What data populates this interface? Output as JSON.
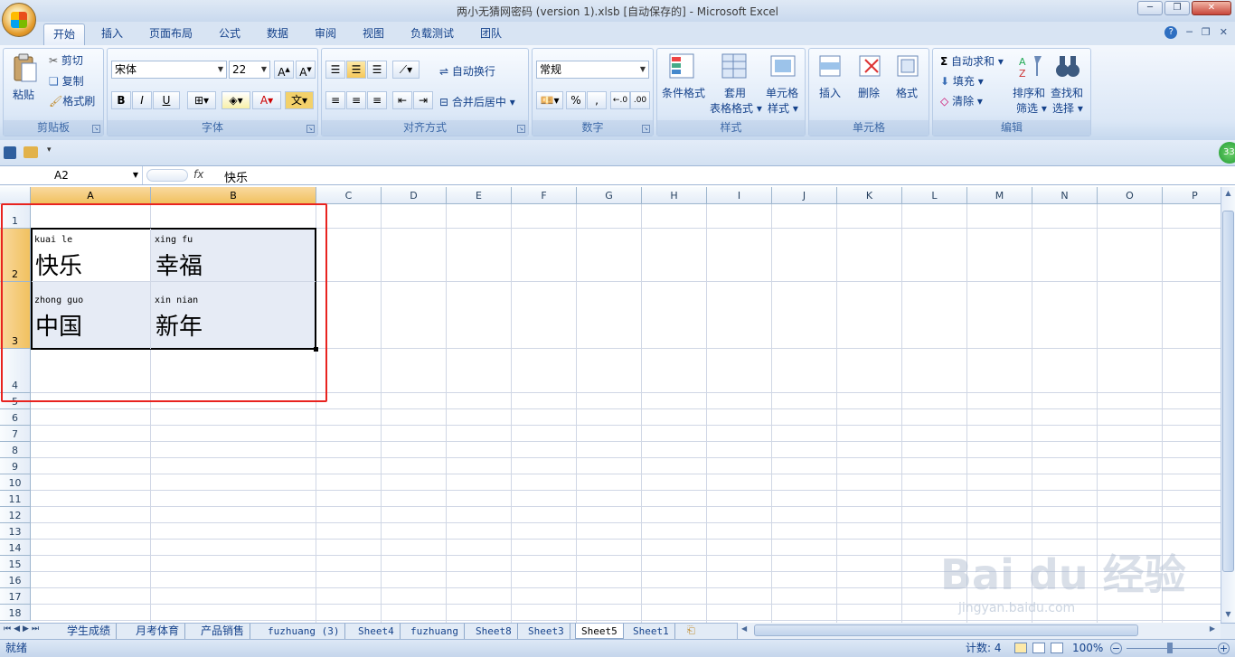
{
  "window": {
    "title": "两小无猜网密码 (version 1).xlsb [自动保存的] - Microsoft Excel"
  },
  "tabs": [
    "开始",
    "插入",
    "页面布局",
    "公式",
    "数据",
    "审阅",
    "视图",
    "负载测试",
    "团队"
  ],
  "clipboard": {
    "paste": "粘贴",
    "cut": "剪切",
    "copy": "复制",
    "format_painter": "格式刷",
    "group": "剪贴板"
  },
  "font": {
    "name": "宋体",
    "size": "22",
    "bold": "B",
    "italic": "I",
    "underline": "U",
    "group": "字体"
  },
  "alignment": {
    "wrap": "自动换行",
    "merge": "合并后居中",
    "group": "对齐方式"
  },
  "number": {
    "format": "常规",
    "percent": "%",
    "comma": ",",
    "group": "数字"
  },
  "styles": {
    "cond": "条件格式",
    "table1": "套用",
    "table2": "表格格式",
    "cell1": "单元格",
    "cell2": "样式",
    "group": "样式"
  },
  "cells": {
    "insert": "插入",
    "delete": "删除",
    "format": "格式",
    "group": "单元格"
  },
  "editing": {
    "autosum": "自动求和",
    "fill": "填充",
    "clear": "清除",
    "sort1": "排序和",
    "sort2": "筛选",
    "find1": "查找和",
    "find2": "选择",
    "group": "编辑"
  },
  "namebox": "A2",
  "formula": "快乐",
  "fx": "fx",
  "columns": [
    "A",
    "B",
    "C",
    "D",
    "E",
    "F",
    "G",
    "H",
    "I",
    "J",
    "K",
    "L",
    "M",
    "N",
    "O",
    "P"
  ],
  "rows": [
    "1",
    "2",
    "3",
    "4",
    "5",
    "6",
    "7",
    "8",
    "9",
    "10",
    "11",
    "12",
    "13",
    "14",
    "15",
    "16",
    "17",
    "18"
  ],
  "cells_data": {
    "a2": {
      "pinyin": "kuai le",
      "text": "快乐"
    },
    "b2": {
      "pinyin": "xing fu",
      "text": "幸福"
    },
    "a3": {
      "pinyin": "zhong guo",
      "text": "中国"
    },
    "b3": {
      "pinyin": "xin nian",
      "text": "新年"
    }
  },
  "sheets": [
    "学生成绩",
    "月考体育",
    "产品销售",
    "fuzhuang (3)",
    "Sheet4",
    "fuzhuang",
    "Sheet8",
    "Sheet3",
    "Sheet5",
    "Sheet1"
  ],
  "active_sheet": "Sheet5",
  "status": {
    "ready": "就绪",
    "count": "计数: 4",
    "zoom": "100%"
  },
  "badge": "33",
  "watermark": {
    "brand": "Bai du 经验",
    "url": "jingyan.baidu.com"
  },
  "colors": {
    "accent": "#15428b",
    "highlight_border": "#e8231f",
    "header_selected": "#f1c15f",
    "selection_fill": "#e6ebf5"
  }
}
